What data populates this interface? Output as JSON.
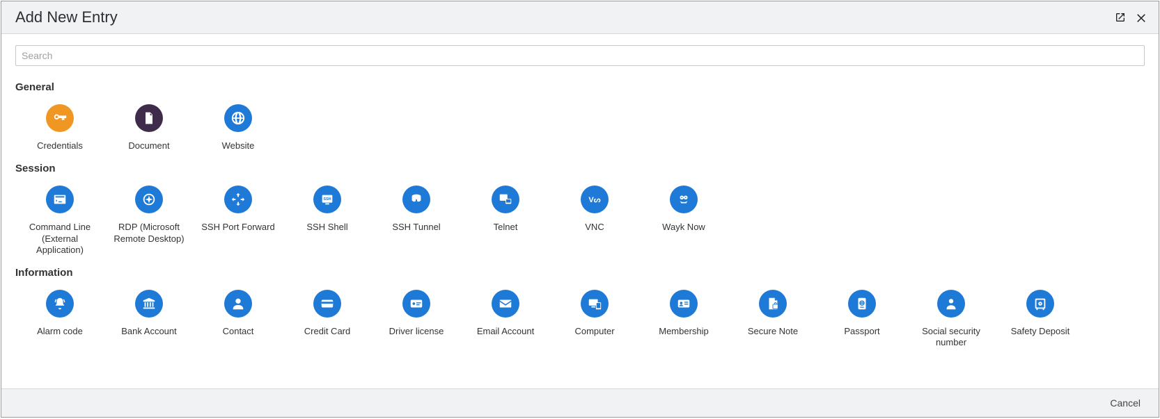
{
  "dialog": {
    "title": "Add New Entry",
    "cancel_label": "Cancel"
  },
  "search": {
    "placeholder": "Search",
    "value": ""
  },
  "sections": {
    "general": {
      "title": "General",
      "items": [
        {
          "label": "Credentials",
          "icon": "key",
          "color": "orange"
        },
        {
          "label": "Document",
          "icon": "document",
          "color": "purple"
        },
        {
          "label": "Website",
          "icon": "globe",
          "color": "blue"
        }
      ]
    },
    "session": {
      "title": "Session",
      "items": [
        {
          "label": "Command Line (External Application)",
          "icon": "terminal",
          "color": "blue"
        },
        {
          "label": "RDP (Microsoft Remote Desktop)",
          "icon": "rdp",
          "color": "blue"
        },
        {
          "label": "SSH Port Forward",
          "icon": "arrows",
          "color": "blue"
        },
        {
          "label": "SSH Shell",
          "icon": "ssh-shell",
          "color": "blue"
        },
        {
          "label": "SSH Tunnel",
          "icon": "ssh-tunnel",
          "color": "blue"
        },
        {
          "label": "Telnet",
          "icon": "telnet",
          "color": "blue"
        },
        {
          "label": "VNC",
          "icon": "vnc",
          "color": "blue"
        },
        {
          "label": "Wayk Now",
          "icon": "wayk",
          "color": "blue"
        }
      ]
    },
    "information": {
      "title": "Information",
      "items": [
        {
          "label": "Alarm code",
          "icon": "bell",
          "color": "blue"
        },
        {
          "label": "Bank Account",
          "icon": "bank",
          "color": "blue"
        },
        {
          "label": "Contact",
          "icon": "person",
          "color": "blue"
        },
        {
          "label": "Credit Card",
          "icon": "credit-card",
          "color": "blue"
        },
        {
          "label": "Driver license",
          "icon": "license",
          "color": "blue"
        },
        {
          "label": "Email Account",
          "icon": "envelope",
          "color": "blue"
        },
        {
          "label": "Computer",
          "icon": "computer",
          "color": "blue"
        },
        {
          "label": "Membership",
          "icon": "membership",
          "color": "blue"
        },
        {
          "label": "Secure Note",
          "icon": "secure-note",
          "color": "blue"
        },
        {
          "label": "Passport",
          "icon": "passport",
          "color": "blue"
        },
        {
          "label": "Social security number",
          "icon": "ssn",
          "color": "blue"
        },
        {
          "label": "Safety Deposit",
          "icon": "safe",
          "color": "blue"
        }
      ]
    }
  }
}
